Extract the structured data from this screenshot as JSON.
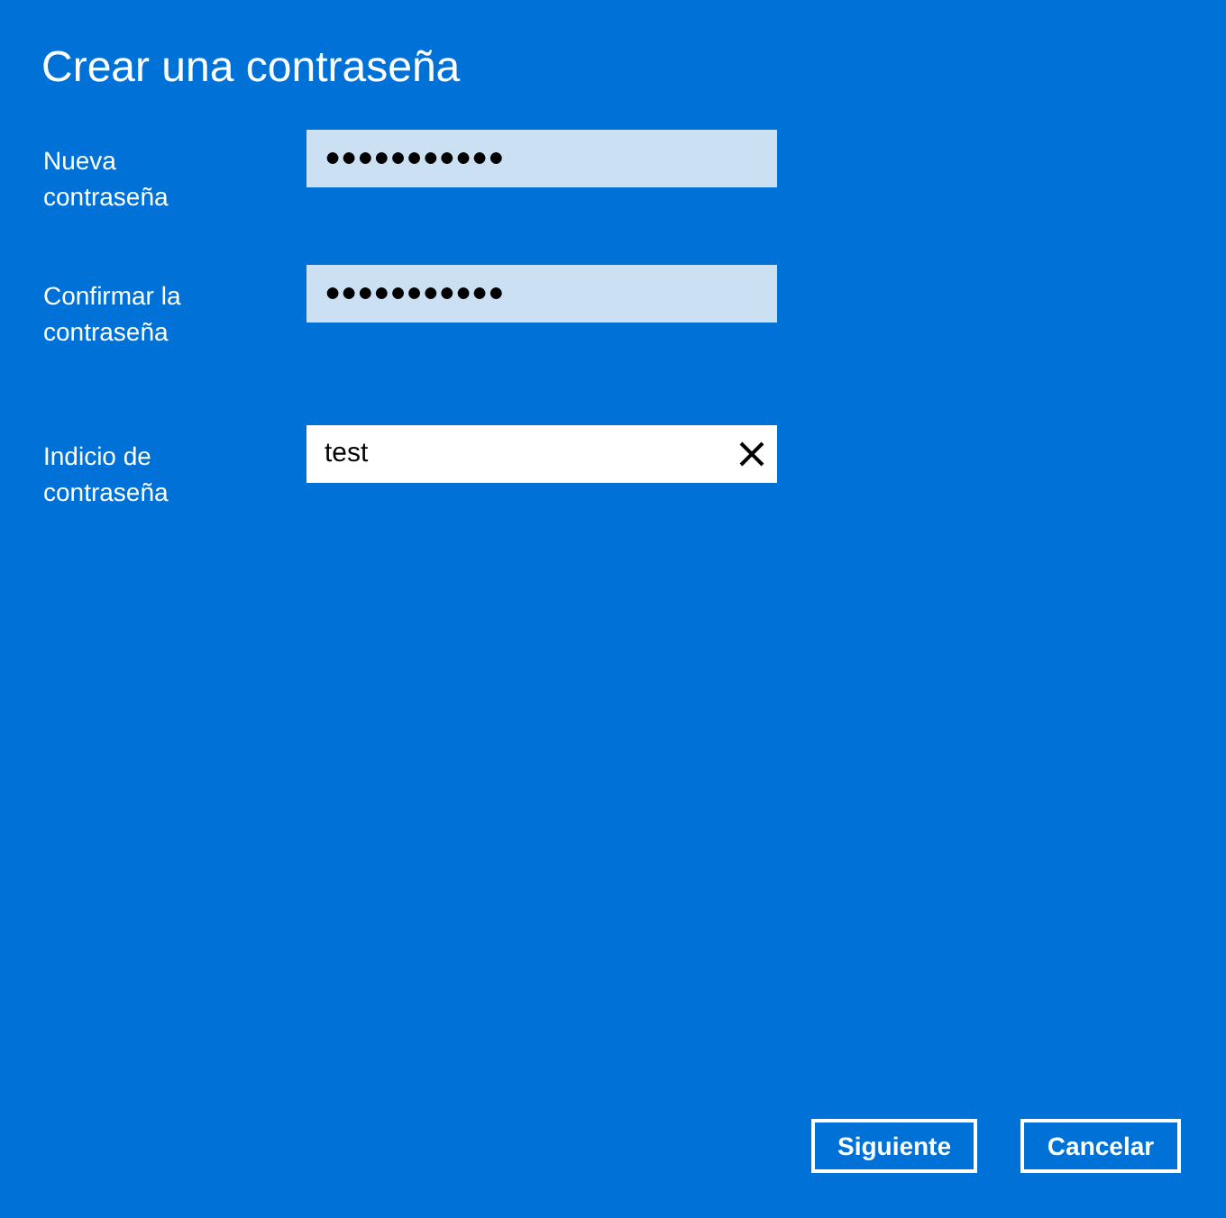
{
  "title": "Crear una contraseña",
  "fields": [
    {
      "label": "Nueva contraseña",
      "value": "●●●●●●●●●●●",
      "focused": false
    },
    {
      "label": "Confirmar la contraseña",
      "value": "●●●●●●●●●●●",
      "focused": false
    },
    {
      "label": "Indicio de contraseña",
      "value": "test",
      "focused": true
    }
  ],
  "buttons": [
    "Siguiente",
    "Cancelar"
  ]
}
